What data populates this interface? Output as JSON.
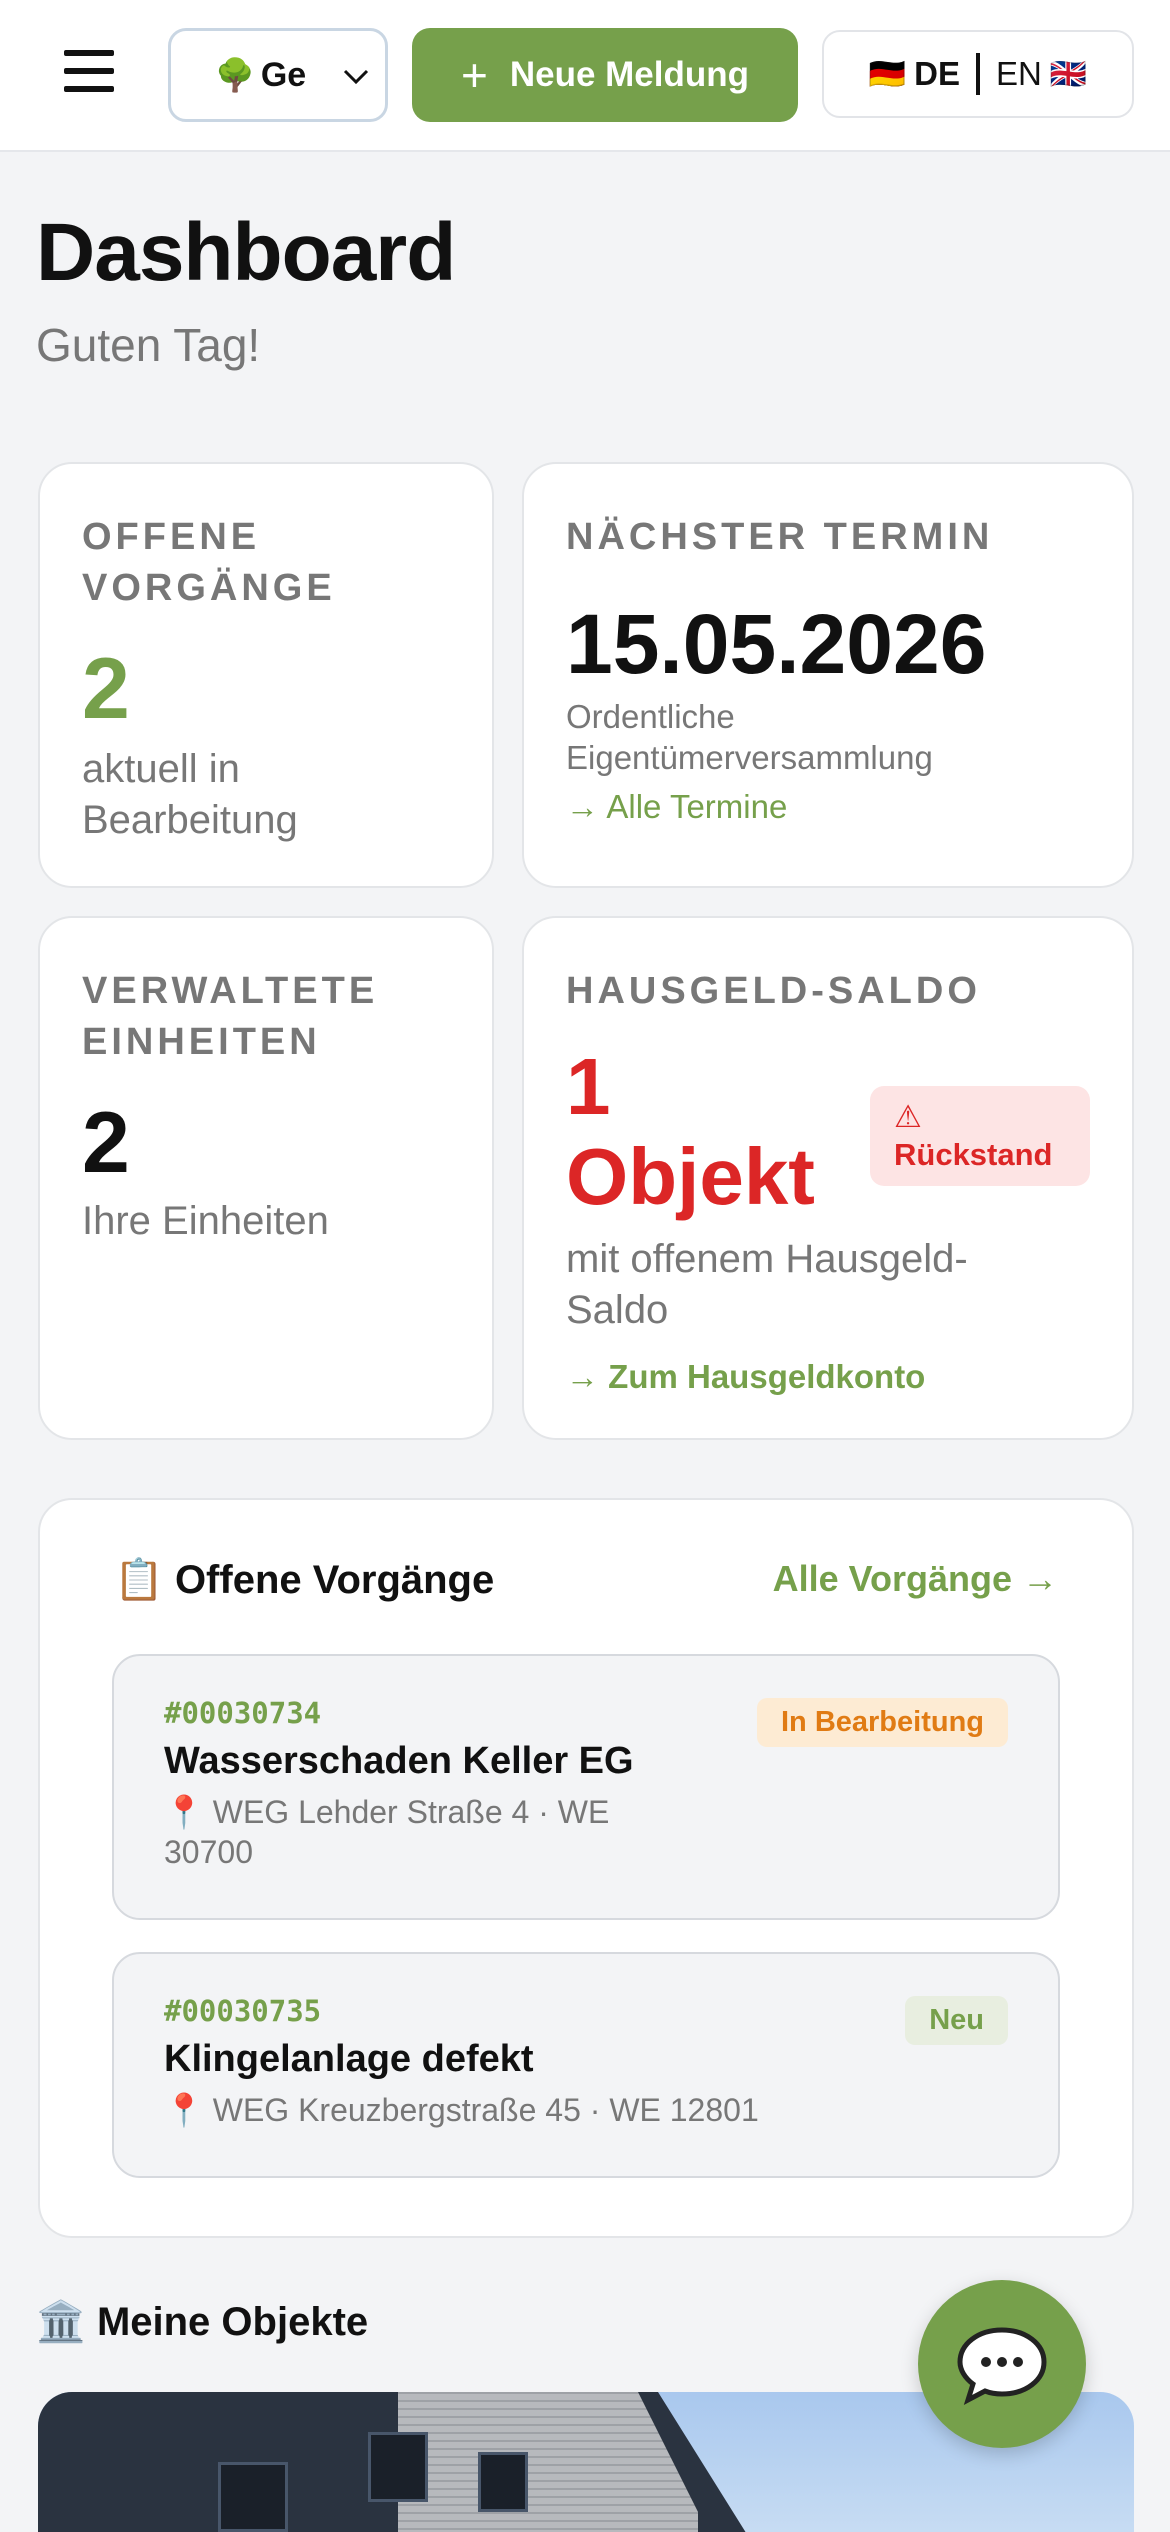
{
  "header": {
    "property_select": "Ge",
    "new_report_label": "Neue Meldung",
    "lang_de": "DE",
    "lang_en": "EN"
  },
  "page": {
    "title": "Dashboard",
    "greeting": "Guten Tag!"
  },
  "cards": {
    "open_cases": {
      "label": "Offene Vorgänge",
      "value": "2",
      "sub": "aktuell in Bearbeitung"
    },
    "next_date": {
      "label": "Nächster Termin",
      "value": "15.05.2026",
      "sub": "Ordentliche Eigentümerversammlung",
      "link": "→ Alle Termine"
    },
    "units": {
      "label": "Verwaltete Einheiten",
      "value": "2",
      "sub": "Ihre Einheiten"
    },
    "balance": {
      "label": "Hausgeld-Saldo",
      "value": "1 Objekt",
      "badge_icon": "⚠",
      "badge": "Rückstand",
      "sub": "mit offenem Hausgeld-Saldo",
      "link": "→ Zum Hausgeldkonto"
    }
  },
  "open_cases": {
    "icon": "📋",
    "title": "Offene Vorgänge",
    "all_link": "Alle Vorgänge →",
    "items": [
      {
        "id": "#00030734",
        "title": "Wasserschaden Keller EG",
        "pin": "📍",
        "location": "WEG Lehder Straße 4 · WE 30700",
        "status": "In Bearbeitung"
      },
      {
        "id": "#00030735",
        "title": "Klingelanlage defekt",
        "pin": "📍",
        "location": "WEG Kreuzbergstraße 45 · WE 12801",
        "status": "Neu"
      }
    ]
  },
  "objects": {
    "icon": "🏛️",
    "title": "Meine Objekte"
  },
  "colors": {
    "accent": "#76a04b",
    "danger": "#dc2626",
    "warning": "#e07b14"
  }
}
